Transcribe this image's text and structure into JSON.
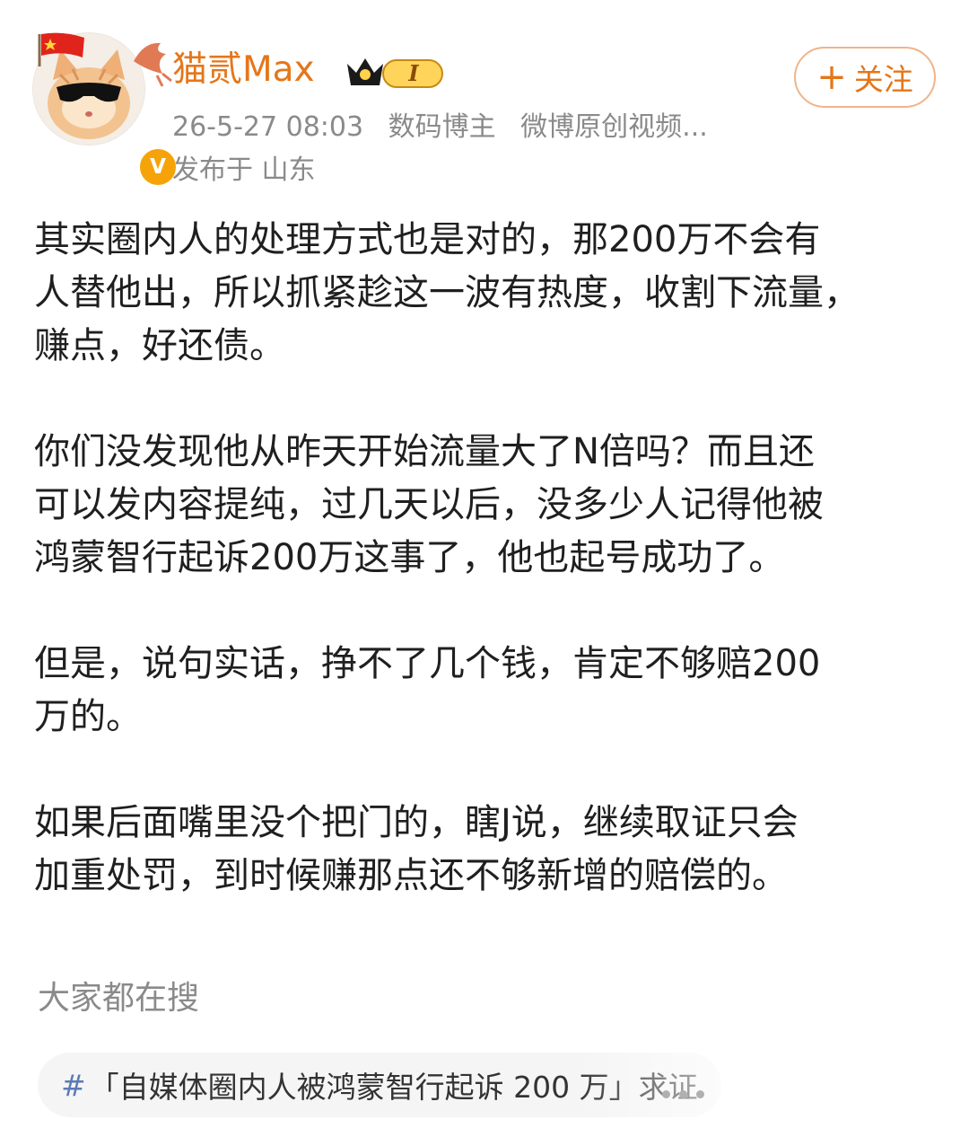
{
  "user": {
    "name": "猫贰Max",
    "timestamp": "26-5-27 08:03",
    "tags": [
      "数码博主",
      "微博原创视频..."
    ],
    "location": "发布于 山东",
    "verified_mark": "V",
    "vip_level": "I"
  },
  "follow_button": {
    "plus": "+",
    "label": "关注"
  },
  "post": {
    "paragraphs": [
      "其实圈内人的处理方式也是对的，那200万不会有\n人替他出，所以抓紧趁这一波有热度，收割下流量，\n赚点，好还债。",
      "你们没发现他从昨天开始流量大了N倍吗？而且还\n可以发内容提纯，过几天以后，没多少人记得他被\n鸿蒙智行起诉200万这事了，他也起号成功了。",
      "但是，说句实话，挣不了几个钱，肯定不够赔200\n万的。",
      "如果后面嘴里没个把门的，瞎J说，继续取证只会\n加重处罚，到时候赚那点还不够新增的赔偿的。"
    ]
  },
  "trending": {
    "title": "大家都在搜",
    "topic_hash": "#",
    "topic_text": "「自媒体圈内人被鸿蒙智行起诉 200 万」求证"
  },
  "colors": {
    "username": "#e5761a",
    "meta_gray": "#8a8a8a",
    "follow_border": "#f0b48a",
    "verified_badge": "#f6a30a",
    "pill_bg": "#f5f5f6"
  },
  "icons": {
    "flag": "china-flag-icon",
    "bird": "bird-sticker-icon",
    "vip": "crown-vip-icon",
    "verified": "verified-v-icon",
    "more": "more-dots-icon"
  }
}
